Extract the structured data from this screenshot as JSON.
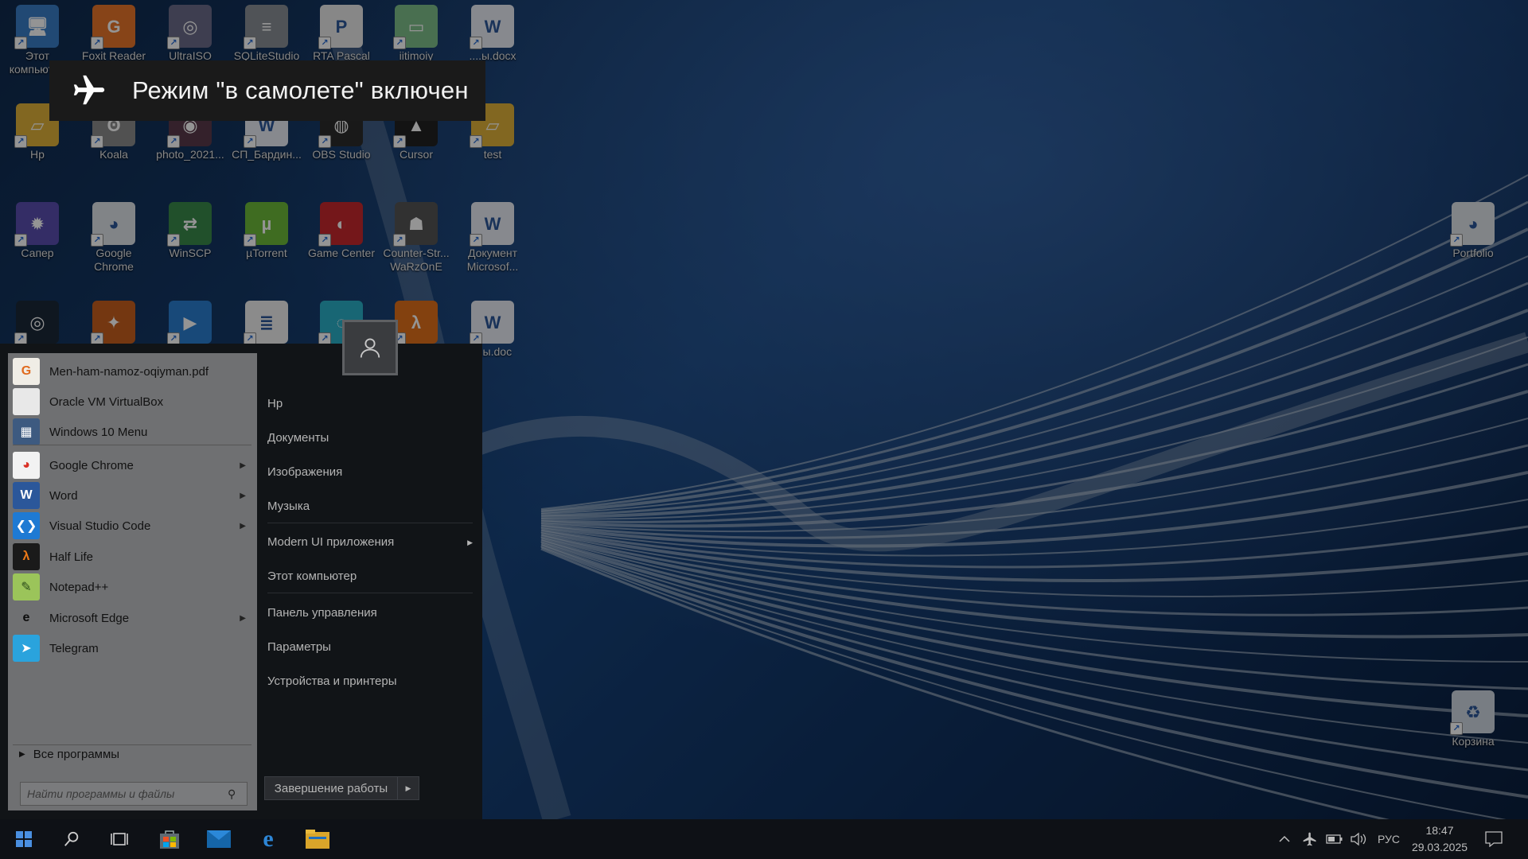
{
  "notification": {
    "text": "Режим \"в самолете\" включен",
    "icon": "airplane-icon"
  },
  "desktop_icons": [
    {
      "label": "Этот\nкомпьютер",
      "icon": "computer-icon"
    },
    {
      "label": "Foxit Reader",
      "icon": "foxit-pdf-icon"
    },
    {
      "label": "UltraISO",
      "icon": "disc-icon"
    },
    {
      "label": "SQLiteStudio",
      "icon": "database-icon"
    },
    {
      "label": "RTA Pascal",
      "icon": "pascal-icon"
    },
    {
      "label": "iitimoiy",
      "icon": "image-file-icon"
    },
    {
      "label": "....ы.docx",
      "icon": "word-doc-icon"
    },
    {
      "label": "Hp",
      "icon": "folder-icon"
    },
    {
      "label": "Koala",
      "icon": "koala-icon"
    },
    {
      "label": "photo_2021...",
      "icon": "photo-icon"
    },
    {
      "label": "СП_Бардин...",
      "icon": "word-doc-icon"
    },
    {
      "label": "OBS Studio",
      "icon": "obs-icon"
    },
    {
      "label": "Cursor",
      "icon": "cursor-app-icon"
    },
    {
      "label": "test",
      "icon": "folder-icon"
    },
    {
      "label": "Сапер",
      "icon": "minesweeper-icon"
    },
    {
      "label": "Google\nChrome",
      "icon": "chrome-icon"
    },
    {
      "label": "WinSCP",
      "icon": "winscp-icon"
    },
    {
      "label": "µTorrent",
      "icon": "utorrent-icon"
    },
    {
      "label": "Game Center",
      "icon": "game-center-icon"
    },
    {
      "label": "Counter-Str...\nWaRzOnE",
      "icon": "counter-strike-icon"
    },
    {
      "label": "Документ\nMicrosof...",
      "icon": "word-doc-icon"
    },
    {
      "label": "",
      "icon": "steam-icon"
    },
    {
      "label": "",
      "icon": "game-shortcut-icon"
    },
    {
      "label": "",
      "icon": "video-editor-icon"
    },
    {
      "label": "",
      "icon": "document-file-icon"
    },
    {
      "label": "",
      "icon": "app-shortcut-icon"
    },
    {
      "label": "",
      "icon": "half-life-icon"
    },
    {
      "label": "...ы.doc",
      "icon": "word-doc-icon"
    },
    {
      "label": "Portfolio",
      "icon": "chrome-icon"
    },
    {
      "label": "Корзина",
      "icon": "recycle-bin-icon"
    }
  ],
  "start_menu": {
    "programs": [
      {
        "label": "Men-ham-namoz-oqiyman.pdf",
        "icon": "pdf-icon",
        "submenu": false
      },
      {
        "label": "Oracle VM VirtualBox",
        "icon": "blank-file-icon",
        "submenu": false
      },
      {
        "label": "Windows 10 Menu",
        "icon": "windows-menu-icon",
        "submenu": false
      },
      {
        "label": "Google Chrome",
        "icon": "chrome-icon",
        "submenu": true
      },
      {
        "label": "Word",
        "icon": "word-icon",
        "submenu": true
      },
      {
        "label": "Visual Studio Code",
        "icon": "vscode-icon",
        "submenu": true
      },
      {
        "label": "Half Life",
        "icon": "half-life-icon",
        "submenu": false
      },
      {
        "label": "Notepad++",
        "icon": "notepad-plus-plus-icon",
        "submenu": false
      },
      {
        "label": "Microsoft Edge",
        "icon": "edge-icon",
        "submenu": true
      },
      {
        "label": "Telegram",
        "icon": "telegram-icon",
        "submenu": false
      }
    ],
    "all_programs": "Все программы",
    "search_placeholder": "Найти программы и файлы",
    "right_items": [
      {
        "label": "Hp",
        "submenu": false
      },
      {
        "label": "Документы",
        "submenu": false
      },
      {
        "label": "Изображения",
        "submenu": false
      },
      {
        "label": "Музыка",
        "submenu": false
      },
      {
        "label": "Modern UI приложения",
        "submenu": true
      },
      {
        "label": "Этот компьютер",
        "submenu": false
      },
      {
        "label": "Панель управления",
        "submenu": false
      },
      {
        "label": "Параметры",
        "submenu": false
      },
      {
        "label": "Устройства и принтеры",
        "submenu": false
      }
    ],
    "shutdown_label": "Завершение работы"
  },
  "taskbar": {
    "pinned": [
      "start-icon",
      "search-icon",
      "task-view-icon",
      "store-icon",
      "mail-icon",
      "edge-icon",
      "file-explorer-icon"
    ],
    "tray": {
      "language": "РУС",
      "time": "18:47",
      "date": "29.03.2025"
    }
  }
}
